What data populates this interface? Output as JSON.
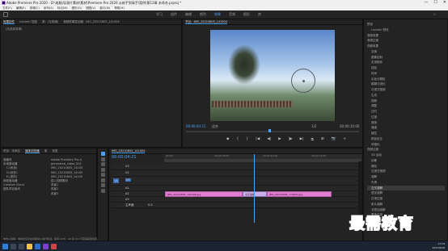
{
  "window": {
    "title": "Adobe Premiere Pro 2020 - D:\\电脑\\导演片素材\\素材\\Premiere Pro 2020 从新手到高手\\案例\\第12章 未命名.prproj *",
    "controls": [
      "—",
      "☐",
      "✕"
    ]
  },
  "menu": [
    "文件(F)",
    "编辑(E)",
    "剪辑(C)",
    "序列(S)",
    "标记(M)",
    "图形(G)",
    "视图(V)",
    "窗口(W)",
    "帮助(H)"
  ],
  "workspaces": [
    "学习",
    "组件",
    "编辑",
    "颜色",
    "效果",
    "音频",
    "图形",
    "库"
  ],
  "active_workspace": "效果",
  "source_panel": {
    "tabs": [
      "效果控件",
      "Lumetri 范围",
      "源：(无剪辑)",
      "音频剪辑混合器：IMG_20210805_141004"
    ],
    "empty_text": "(未选择剪辑)"
  },
  "program_monitor": {
    "tab": "节目：IMG_20210805_141004",
    "timecode": "00:00:04:21",
    "fit": "适合",
    "quality": "1/2",
    "duration": "00:00:10:00",
    "transport": [
      "◆",
      "{",
      "}",
      "|◀",
      "◀|",
      "▶",
      "|▶",
      "▶|",
      "⧉",
      "⊞",
      "📷",
      "+"
    ]
  },
  "project_panel": {
    "tabs": [
      "项目：未命名",
      "媒体浏览器",
      "库",
      "信息"
    ],
    "tree_items": [
      "收藏夹",
      "本地驱动器",
      "C:(系统)",
      "D:(软件)",
      "E:(资料)",
      "网络驱动器",
      "Creative Cloud",
      "团队项目版本"
    ],
    "files": [
      "Adobe Premiere Pro A",
      "generated_video_001",
      "IMG_20210805_14100",
      "IMG_20210805_14100",
      "IMG_20210805_14100",
      "插入视频素材",
      "风景1",
      "风景2",
      "风景3"
    ]
  },
  "timeline": {
    "tab": "IMG_20210805_141004",
    "timecode": "00:00:04:21",
    "tracks": [
      "V3",
      "V2",
      "V1",
      "A1",
      "A2",
      "A3",
      "主声道"
    ],
    "master_value": "0.0",
    "ruler_labels": [
      "00:00",
      "00:00:05:00",
      "00:00:10:00",
      "00:00:15:00"
    ],
    "clips": [
      {
        "label": "IMG_20210805_141004.jpg",
        "track": "V1"
      },
      {
        "label": "交叉溶解",
        "track": "V1"
      },
      {
        "label": "IMG_20210805_174807.jpg",
        "track": "V1"
      }
    ]
  },
  "effects_panel": {
    "items": [
      "预设",
      "Lumetri 预设",
      "音频效果",
      "音频过渡",
      "视频效果",
      "变换",
      "图像控制",
      "实用程序",
      "扭曲",
      "时间",
      "杂色与颗粒",
      "模糊与锐化",
      "沉浸式视频",
      "生成",
      "视频",
      "调整",
      "过时",
      "过渡",
      "透视",
      "通道",
      "键控",
      "颜色校正",
      "风格化",
      "视频过渡",
      "3D 运动",
      "划像",
      "擦除",
      "沉浸式视频",
      "溶解",
      "内滑",
      "交叉溶解",
      "叠加溶解",
      "白场过渡",
      "胶片溶解",
      "非叠加溶解",
      "黑场过渡",
      "缩放",
      "页面剥落"
    ],
    "selected": "交叉溶解"
  },
  "status_text": "单击以选择，或单击空白处并拖动以进行框选。使用 Shift、Alt 和 Ctrl 可获得其他选项。",
  "clock": {
    "time": "17:24",
    "date": "2021/8/28"
  },
  "watermark": "最需教育"
}
